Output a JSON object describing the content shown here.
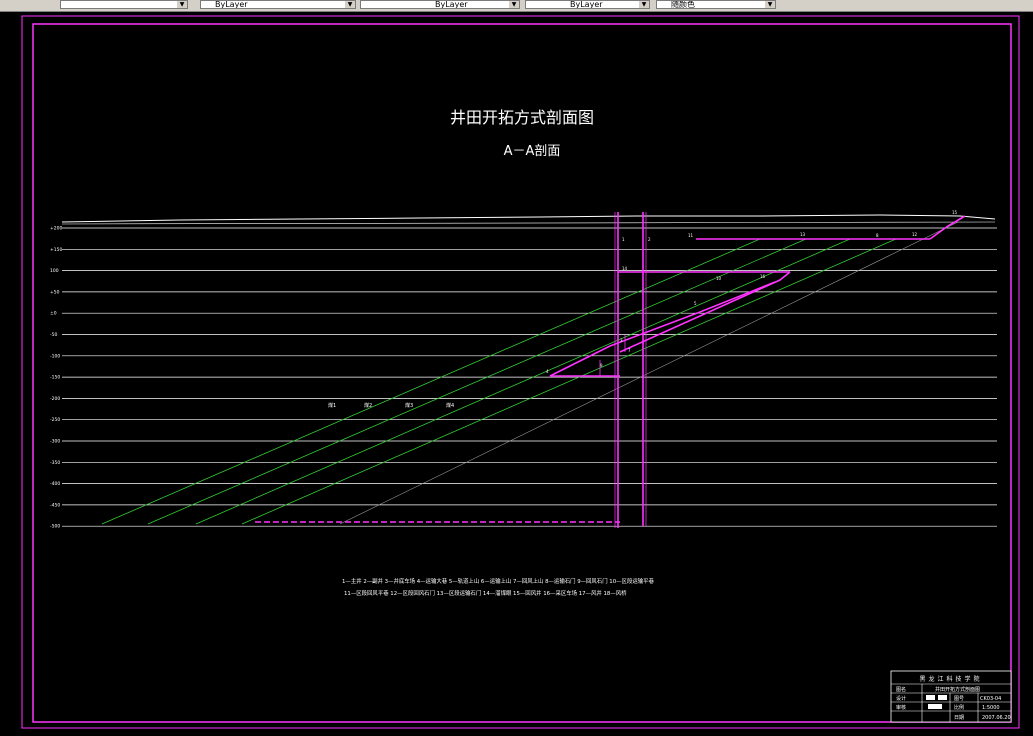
{
  "toolbar": {
    "layer_combo": "",
    "color_combo": "ByLayer",
    "linetype_combo": "ByLayer",
    "lineweight_combo": "ByLayer",
    "plotstyle_combo": "随颜色"
  },
  "drawing": {
    "title": "井田开拓方式剖面图",
    "subtitle": "A－A剖面",
    "elevations": [
      "+200",
      "+150",
      "100",
      "+50",
      "±0",
      "-50",
      "-100",
      "-150",
      "-200",
      "-250",
      "-300",
      "-350",
      "-400",
      "-450",
      "-500"
    ],
    "seam_labels": [
      "煤1",
      "煤2",
      "煤3",
      "煤4"
    ],
    "legend_line1": "1—主井  2—副井  3—井底车场  4—运输大巷  5—轨道上山  6—运输上山  7—回风上山  8—运输石门  9—回风石门  10—区段运输平巷",
    "legend_line2": "11—区段回风平巷  12—区段回风石门  13—区段运输石门  14—溜煤眼  15—回风井  16—采区车场  17—风井  18—风桥",
    "colors": {
      "seam": "#33cc33",
      "roadway": "#ff33ff",
      "frame": "#ff33ff",
      "level": "#ffffff"
    },
    "title_block": {
      "school": "黑龙江科技学院",
      "name_label": "图名",
      "name_value": "井田开拓方式剖面图",
      "design_label": "设计",
      "check_label": "审核",
      "number_label": "图号",
      "number_value": "CK03-04",
      "scale_label": "比例",
      "scale_value": "1:5000",
      "date_label": "日期",
      "date_value": "2007.06.20"
    }
  }
}
